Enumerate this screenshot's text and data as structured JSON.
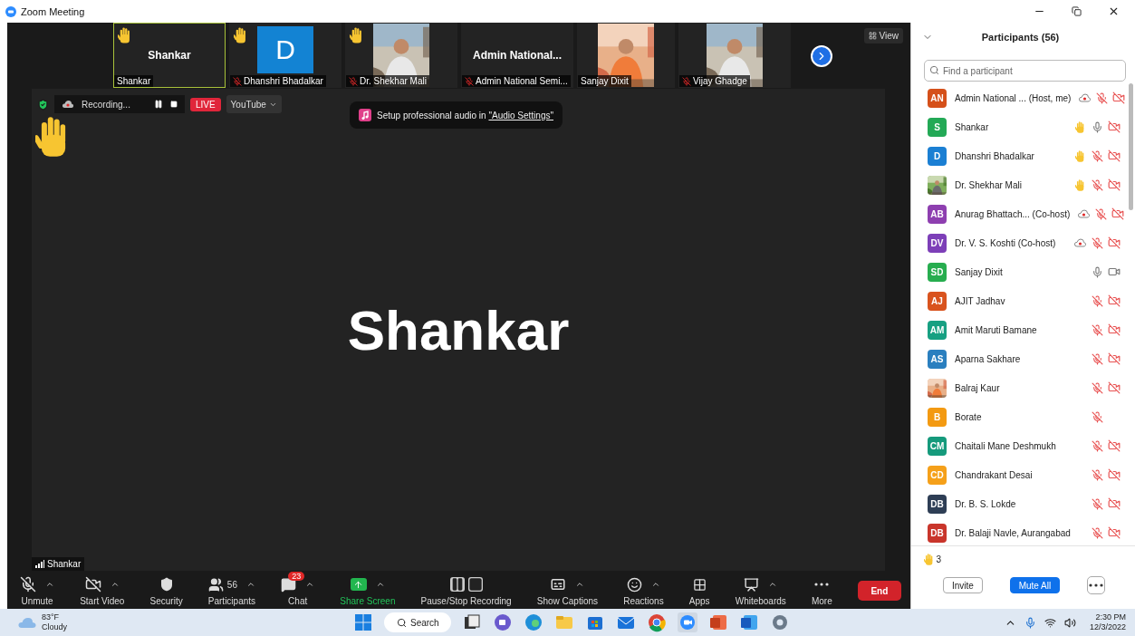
{
  "window": {
    "title": "Zoom Meeting"
  },
  "thumbnails": [
    {
      "kind": "name",
      "name": "Shankar",
      "label": "Shankar",
      "hand": true,
      "muted": false,
      "selected": true
    },
    {
      "kind": "initial",
      "initial": "D",
      "label": "Dhanshri Bhadalkar",
      "hand": true,
      "muted": true,
      "selected": false
    },
    {
      "label": "Dr. Shekhar Mali",
      "hand": true,
      "muted": true,
      "selected": false
    },
    {
      "kind": "name",
      "name": "Admin  National...",
      "label": "Admin National Semi...",
      "hand": false,
      "muted": true,
      "selected": false
    },
    {
      "label": "Sanjay Dixit",
      "hand": false,
      "muted": false,
      "selected": false
    },
    {
      "label": "Vijay Ghadge",
      "hand": false,
      "muted": true,
      "selected": false
    }
  ],
  "view_button": "View",
  "recording_bar": {
    "status": "Recording...",
    "live": "LIVE",
    "stream": "YouTube"
  },
  "banner": {
    "text": "Setup professional audio in ",
    "link": "\"Audio Settings\""
  },
  "speaker": {
    "name": "Shankar",
    "hand": true,
    "tag": "Shankar"
  },
  "toolbar": [
    {
      "kind": "unmute",
      "label": "Unmute",
      "caret": true
    },
    {
      "kind": "video",
      "label": "Start Video",
      "caret": true
    },
    {
      "kind": "security",
      "label": "Security",
      "caret": false
    },
    {
      "kind": "participants",
      "label": "Participants",
      "count": "56",
      "caret": true
    },
    {
      "kind": "chat",
      "label": "Chat",
      "badge": "23",
      "caret": true
    },
    {
      "kind": "share",
      "label": "Share Screen",
      "caret": true
    },
    {
      "kind": "recording",
      "label": "Pause/Stop Recording",
      "caret": false
    },
    {
      "kind": "captions",
      "label": "Show Captions",
      "caret": true
    },
    {
      "kind": "reactions",
      "label": "Reactions",
      "caret": true
    },
    {
      "kind": "apps",
      "label": "Apps",
      "caret": false
    },
    {
      "kind": "whiteboards",
      "label": "Whiteboards",
      "caret": true
    },
    {
      "kind": "more",
      "label": "More",
      "caret": false
    }
  ],
  "end_button": "End",
  "panel": {
    "title": "Participants (56)",
    "search_placeholder": "Find a participant",
    "raised_hands": "3",
    "buttons": [
      "Invite",
      "Mute All"
    ]
  },
  "participants": [
    {
      "kind": "initials",
      "initials": "AN",
      "color": "#d5501a",
      "name": "Admin National ... (Host, me)",
      "recording": true,
      "hand": false,
      "muted": true,
      "video_off": true
    },
    {
      "kind": "initials",
      "initials": "S",
      "color": "#23a956",
      "name": "Shankar",
      "recording": false,
      "hand": true,
      "muted": false,
      "video_off": true
    },
    {
      "kind": "initials",
      "initials": "D",
      "color": "#1b7fd3",
      "name": "Dhanshri Bhadalkar",
      "recording": false,
      "hand": true,
      "muted": true,
      "video_off": true
    },
    {
      "name": "Dr. Shekhar Mali",
      "recording": false,
      "hand": true,
      "muted": true,
      "video_off": true
    },
    {
      "kind": "initials",
      "initials": "AB",
      "color": "#8e3fb0",
      "name": "Anurag Bhattach...  (Co-host)",
      "recording": true,
      "hand": false,
      "muted": true,
      "video_off": true
    },
    {
      "kind": "initials",
      "initials": "DV",
      "color": "#7d3fb8",
      "name": "Dr. V. S. Koshti (Co-host)",
      "recording": true,
      "hand": false,
      "muted": true,
      "video_off": true
    },
    {
      "kind": "initials",
      "initials": "SD",
      "color": "#27ad4f",
      "name": "Sanjay Dixit",
      "recording": false,
      "hand": false,
      "muted": false,
      "video_off": false
    },
    {
      "kind": "initials",
      "initials": "AJ",
      "color": "#d9531e",
      "name": "AJIT Jadhav",
      "recording": false,
      "hand": false,
      "muted": true,
      "video_off": true
    },
    {
      "kind": "initials",
      "initials": "AM",
      "color": "#17a082",
      "name": "Amit Maruti Bamane",
      "recording": false,
      "hand": false,
      "muted": true,
      "video_off": true
    },
    {
      "kind": "initials",
      "initials": "AS",
      "color": "#2a7fbf",
      "name": "Aparna Sakhare",
      "recording": false,
      "hand": false,
      "muted": true,
      "video_off": true
    },
    {
      "name": "Balraj Kaur",
      "recording": false,
      "hand": false,
      "muted": true,
      "video_off": true
    },
    {
      "kind": "initials",
      "initials": "B",
      "color": "#f39a12",
      "name": "Borate",
      "recording": false,
      "hand": false,
      "muted": true
    },
    {
      "kind": "initials",
      "initials": "CM",
      "color": "#159a7c",
      "name": "Chaitali Mane Deshmukh",
      "recording": false,
      "hand": false,
      "muted": true,
      "video_off": true
    },
    {
      "kind": "initials",
      "initials": "CD",
      "color": "#f5a01a",
      "name": "Chandrakant Desai",
      "recording": false,
      "hand": false,
      "muted": true,
      "video_off": true
    },
    {
      "kind": "initials",
      "initials": "DB",
      "color": "#2e3e55",
      "name": "Dr. B. S. Lokde",
      "recording": false,
      "hand": false,
      "muted": true,
      "video_off": true
    },
    {
      "kind": "initials",
      "initials": "DB",
      "color": "#c9352b",
      "name": "Dr. Balaji Navle, Aurangabad",
      "recording": false,
      "hand": false,
      "muted": true,
      "video_off": true
    }
  ],
  "taskbar": {
    "temperature": "83°F",
    "weather": "Cloudy",
    "search": "Search",
    "apps": [
      {
        "kind": "files"
      },
      {
        "kind": "meet"
      },
      {
        "kind": "edge"
      },
      {
        "kind": "folder"
      },
      {
        "kind": "store"
      },
      {
        "kind": "mail"
      },
      {
        "kind": "chrome"
      },
      {
        "kind": "zoom"
      },
      {
        "kind": "powerpoint"
      },
      {
        "kind": "word"
      },
      {
        "kind": "settings"
      }
    ],
    "time": "2:30 PM",
    "date": "12/3/2022"
  }
}
